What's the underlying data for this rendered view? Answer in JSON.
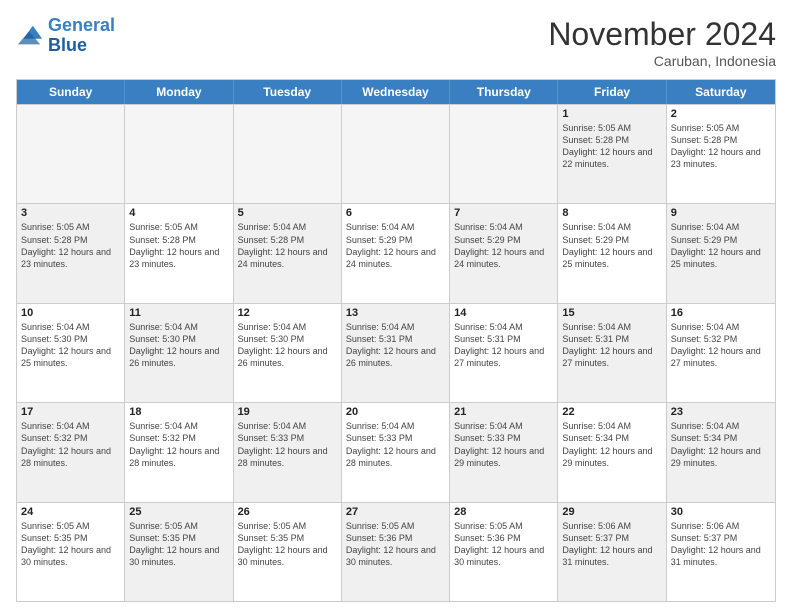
{
  "logo": {
    "line1": "General",
    "line2": "Blue"
  },
  "title": "November 2024",
  "location": "Caruban, Indonesia",
  "header_days": [
    "Sunday",
    "Monday",
    "Tuesday",
    "Wednesday",
    "Thursday",
    "Friday",
    "Saturday"
  ],
  "weeks": [
    [
      {
        "day": "",
        "info": "",
        "empty": true
      },
      {
        "day": "",
        "info": "",
        "empty": true
      },
      {
        "day": "",
        "info": "",
        "empty": true
      },
      {
        "day": "",
        "info": "",
        "empty": true
      },
      {
        "day": "",
        "info": "",
        "empty": true
      },
      {
        "day": "1",
        "info": "Sunrise: 5:05 AM\nSunset: 5:28 PM\nDaylight: 12 hours\nand 22 minutes.",
        "shaded": true
      },
      {
        "day": "2",
        "info": "Sunrise: 5:05 AM\nSunset: 5:28 PM\nDaylight: 12 hours\nand 23 minutes.",
        "shaded": false
      }
    ],
    [
      {
        "day": "3",
        "info": "Sunrise: 5:05 AM\nSunset: 5:28 PM\nDaylight: 12 hours\nand 23 minutes.",
        "shaded": true
      },
      {
        "day": "4",
        "info": "Sunrise: 5:05 AM\nSunset: 5:28 PM\nDaylight: 12 hours\nand 23 minutes.",
        "shaded": false
      },
      {
        "day": "5",
        "info": "Sunrise: 5:04 AM\nSunset: 5:28 PM\nDaylight: 12 hours\nand 24 minutes.",
        "shaded": true
      },
      {
        "day": "6",
        "info": "Sunrise: 5:04 AM\nSunset: 5:29 PM\nDaylight: 12 hours\nand 24 minutes.",
        "shaded": false
      },
      {
        "day": "7",
        "info": "Sunrise: 5:04 AM\nSunset: 5:29 PM\nDaylight: 12 hours\nand 24 minutes.",
        "shaded": true
      },
      {
        "day": "8",
        "info": "Sunrise: 5:04 AM\nSunset: 5:29 PM\nDaylight: 12 hours\nand 25 minutes.",
        "shaded": false
      },
      {
        "day": "9",
        "info": "Sunrise: 5:04 AM\nSunset: 5:29 PM\nDaylight: 12 hours\nand 25 minutes.",
        "shaded": true
      }
    ],
    [
      {
        "day": "10",
        "info": "Sunrise: 5:04 AM\nSunset: 5:30 PM\nDaylight: 12 hours\nand 25 minutes.",
        "shaded": false
      },
      {
        "day": "11",
        "info": "Sunrise: 5:04 AM\nSunset: 5:30 PM\nDaylight: 12 hours\nand 26 minutes.",
        "shaded": true
      },
      {
        "day": "12",
        "info": "Sunrise: 5:04 AM\nSunset: 5:30 PM\nDaylight: 12 hours\nand 26 minutes.",
        "shaded": false
      },
      {
        "day": "13",
        "info": "Sunrise: 5:04 AM\nSunset: 5:31 PM\nDaylight: 12 hours\nand 26 minutes.",
        "shaded": true
      },
      {
        "day": "14",
        "info": "Sunrise: 5:04 AM\nSunset: 5:31 PM\nDaylight: 12 hours\nand 27 minutes.",
        "shaded": false
      },
      {
        "day": "15",
        "info": "Sunrise: 5:04 AM\nSunset: 5:31 PM\nDaylight: 12 hours\nand 27 minutes.",
        "shaded": true
      },
      {
        "day": "16",
        "info": "Sunrise: 5:04 AM\nSunset: 5:32 PM\nDaylight: 12 hours\nand 27 minutes.",
        "shaded": false
      }
    ],
    [
      {
        "day": "17",
        "info": "Sunrise: 5:04 AM\nSunset: 5:32 PM\nDaylight: 12 hours\nand 28 minutes.",
        "shaded": true
      },
      {
        "day": "18",
        "info": "Sunrise: 5:04 AM\nSunset: 5:32 PM\nDaylight: 12 hours\nand 28 minutes.",
        "shaded": false
      },
      {
        "day": "19",
        "info": "Sunrise: 5:04 AM\nSunset: 5:33 PM\nDaylight: 12 hours\nand 28 minutes.",
        "shaded": true
      },
      {
        "day": "20",
        "info": "Sunrise: 5:04 AM\nSunset: 5:33 PM\nDaylight: 12 hours\nand 28 minutes.",
        "shaded": false
      },
      {
        "day": "21",
        "info": "Sunrise: 5:04 AM\nSunset: 5:33 PM\nDaylight: 12 hours\nand 29 minutes.",
        "shaded": true
      },
      {
        "day": "22",
        "info": "Sunrise: 5:04 AM\nSunset: 5:34 PM\nDaylight: 12 hours\nand 29 minutes.",
        "shaded": false
      },
      {
        "day": "23",
        "info": "Sunrise: 5:04 AM\nSunset: 5:34 PM\nDaylight: 12 hours\nand 29 minutes.",
        "shaded": true
      }
    ],
    [
      {
        "day": "24",
        "info": "Sunrise: 5:05 AM\nSunset: 5:35 PM\nDaylight: 12 hours\nand 30 minutes.",
        "shaded": false
      },
      {
        "day": "25",
        "info": "Sunrise: 5:05 AM\nSunset: 5:35 PM\nDaylight: 12 hours\nand 30 minutes.",
        "shaded": true
      },
      {
        "day": "26",
        "info": "Sunrise: 5:05 AM\nSunset: 5:35 PM\nDaylight: 12 hours\nand 30 minutes.",
        "shaded": false
      },
      {
        "day": "27",
        "info": "Sunrise: 5:05 AM\nSunset: 5:36 PM\nDaylight: 12 hours\nand 30 minutes.",
        "shaded": true
      },
      {
        "day": "28",
        "info": "Sunrise: 5:05 AM\nSunset: 5:36 PM\nDaylight: 12 hours\nand 30 minutes.",
        "shaded": false
      },
      {
        "day": "29",
        "info": "Sunrise: 5:06 AM\nSunset: 5:37 PM\nDaylight: 12 hours\nand 31 minutes.",
        "shaded": true
      },
      {
        "day": "30",
        "info": "Sunrise: 5:06 AM\nSunset: 5:37 PM\nDaylight: 12 hours\nand 31 minutes.",
        "shaded": false
      }
    ]
  ]
}
